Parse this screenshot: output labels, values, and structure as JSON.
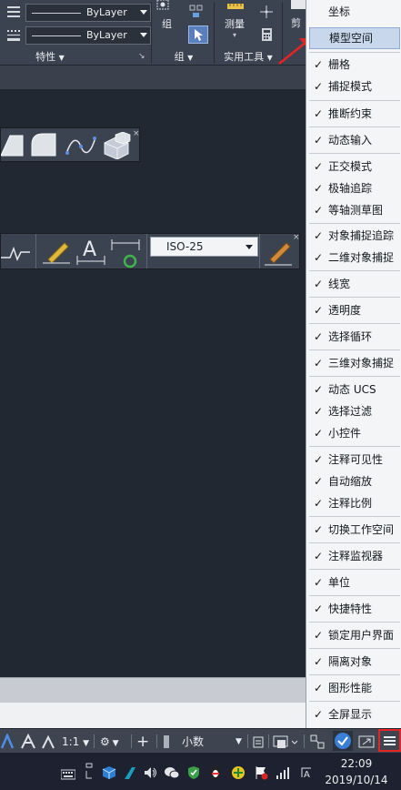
{
  "ribbon": {
    "layer_bylayer_1": "ByLayer",
    "layer_bylayer_2": "ByLayer",
    "panel_properties": "特性",
    "group_label": "组",
    "panel_group": "组",
    "measure_label": "测量",
    "panel_utilities": "实用工具",
    "clip_label": "剪"
  },
  "toolbar": {
    "dim_style_value": "ISO-25"
  },
  "status_bar": {
    "scale": "1:1",
    "units": "小数"
  },
  "taskbar": {
    "time": "22:09",
    "date": "2019/10/14"
  },
  "menu": {
    "items": [
      {
        "label": "坐标",
        "checked": false
      },
      {
        "label": "模型空间",
        "checked": false,
        "highlighted": true
      },
      {
        "label": "栅格",
        "checked": true
      },
      {
        "label": "捕捉模式",
        "checked": true
      },
      {
        "label": "推断约束",
        "checked": true
      },
      {
        "label": "动态输入",
        "checked": true
      },
      {
        "label": "正交模式",
        "checked": true
      },
      {
        "label": "极轴追踪",
        "checked": true
      },
      {
        "label": "等轴测草图",
        "checked": true
      },
      {
        "label": "对象捕捉追踪",
        "checked": true
      },
      {
        "label": "二维对象捕捉",
        "checked": true
      },
      {
        "label": "线宽",
        "checked": true
      },
      {
        "label": "透明度",
        "checked": true
      },
      {
        "label": "选择循环",
        "checked": true
      },
      {
        "label": "三维对象捕捉",
        "checked": true
      },
      {
        "label": "动态 UCS",
        "checked": true
      },
      {
        "label": "选择过滤",
        "checked": true
      },
      {
        "label": "小控件",
        "checked": true
      },
      {
        "label": "注释可见性",
        "checked": true
      },
      {
        "label": "自动缩放",
        "checked": true
      },
      {
        "label": "注释比例",
        "checked": true
      },
      {
        "label": "切换工作空间",
        "checked": true
      },
      {
        "label": "注释监视器",
        "checked": true
      },
      {
        "label": "单位",
        "checked": true
      },
      {
        "label": "快捷特性",
        "checked": true
      },
      {
        "label": "锁定用户界面",
        "checked": true
      },
      {
        "label": "隔离对象",
        "checked": true
      },
      {
        "label": "图形性能",
        "checked": true
      },
      {
        "label": "全屏显示",
        "checked": true
      }
    ]
  },
  "colors": {
    "highlight": "#c9d7ec",
    "annotation_red": "#e52424"
  }
}
